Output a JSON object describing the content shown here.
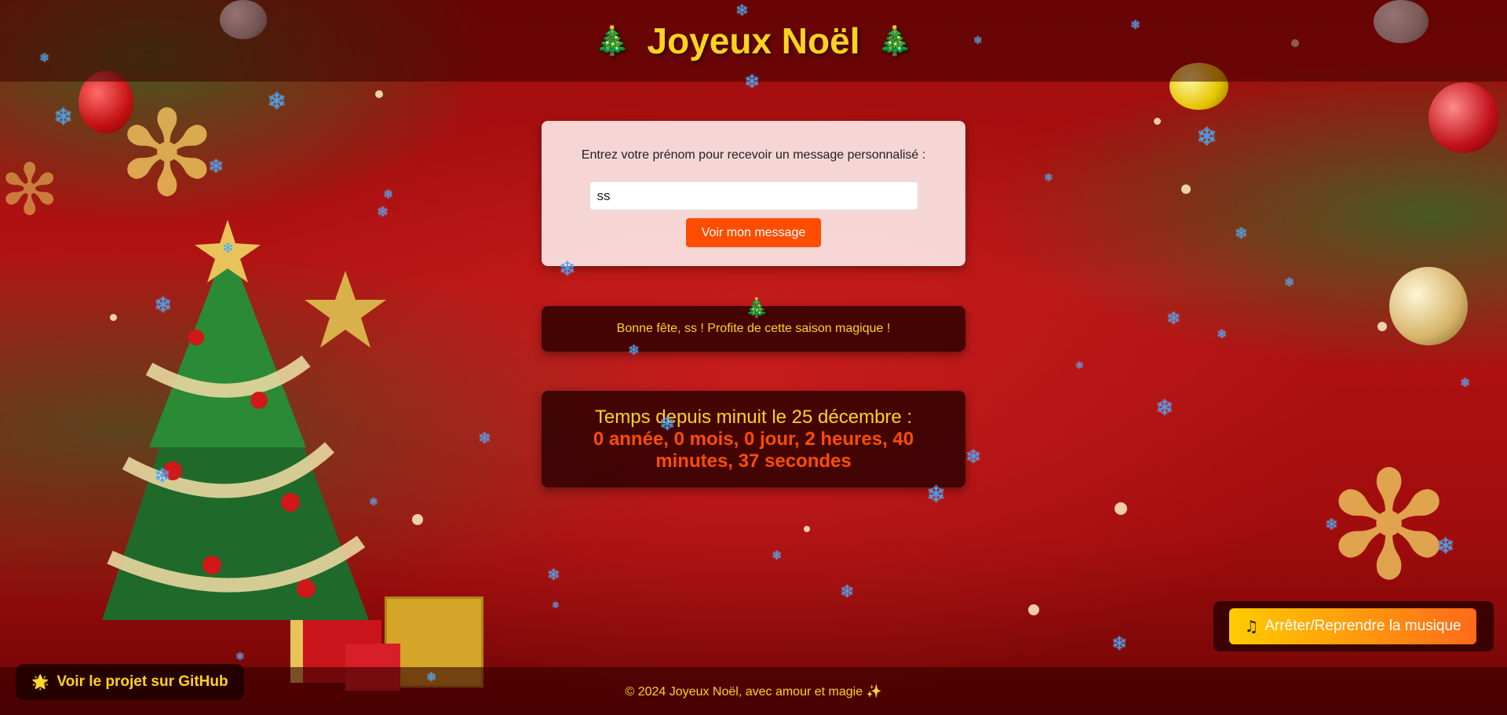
{
  "header": {
    "title": "Joyeux Noël",
    "left_icon": "🎄",
    "right_icon": "🎄"
  },
  "form": {
    "label": "Entrez votre prénom pour recevoir un message personnalisé :",
    "name_value": "ss",
    "submit_label": "Voir mon message"
  },
  "message": {
    "text": "Bonne fête, ss ! Profite de cette saison magique !"
  },
  "timer": {
    "label": "Temps depuis minuit le 25 décembre :",
    "value": "0 année, 0 mois, 0 jour, 2 heures, 40 minutes, 37 secondes"
  },
  "music": {
    "icon": "♫",
    "label": "Arrêter/Reprendre la musique"
  },
  "github": {
    "icon": "🌟",
    "label": "Voir le projet sur GitHub"
  },
  "footer": {
    "text": "© 2024 Joyeux Noël, avec amour et magie ✨"
  },
  "colors": {
    "accent": "#ffd21f",
    "button": "#ff4d00",
    "snow": "#3aa3ff",
    "background": "#b31313"
  },
  "decor": {
    "snowflake_glyph": "❄",
    "tree_glyph": "🎄"
  }
}
